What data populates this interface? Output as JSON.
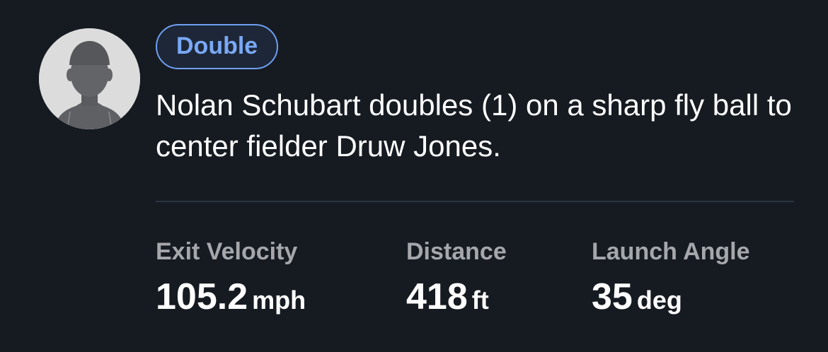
{
  "play": {
    "badge": "Double",
    "description": "Nolan Schubart doubles (1) on a sharp fly ball to center fielder Druw Jones.",
    "avatar_icon": "player-silhouette-icon"
  },
  "stats": [
    {
      "label": "Exit Velocity",
      "value": "105.2",
      "unit": "mph"
    },
    {
      "label": "Distance",
      "value": "418",
      "unit": "ft"
    },
    {
      "label": "Launch Angle",
      "value": "35",
      "unit": "deg"
    }
  ],
  "colors": {
    "background": "#161b22",
    "badge_accent": "#7aa8f5",
    "label_gray": "#a5a7ab",
    "divider": "#2b3443"
  }
}
